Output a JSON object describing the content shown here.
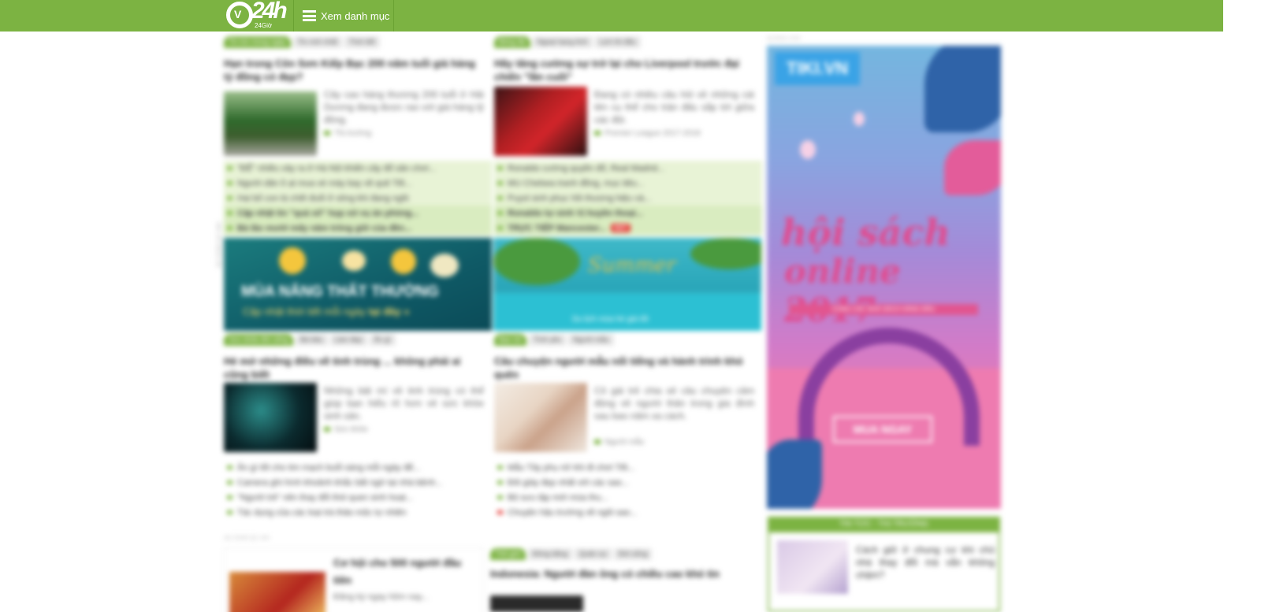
{
  "header": {
    "logo_text": "24h",
    "logo_letter": "V",
    "logo_sub": "24Giờ",
    "menu_label": "Xem danh mục"
  },
  "colors": {
    "brand": "#7cb342",
    "hot": "#e53935"
  },
  "icons": {
    "menu": "hamburger-icon",
    "bullet": "square-bullet-icon"
  },
  "left_col": {
    "block1": {
      "tags": [
        "Tin tức trong ngày",
        "Tin mới nhất",
        "Thời tiết"
      ],
      "headline": "Hạn trong Côn Sơn Kiếp Bạc 200 năm tuổi giá hàng tỷ đồng có đẹp?",
      "summary": "Cây cao hàng thương 200 tuổi ở Hải Dương đang được rao với giá hàng tỷ đồng.",
      "category": "Thị trường",
      "links": [
        "\"ĐỂ\" nhiều xảy ra ở Hà Nội khiến cây đổ sân chơi...",
        "Người dân ồ ạt mua vé máy bay về quê Tết...",
        "Hai bố con bị chết đuối ở sông khi đang ngồi",
        "Cập nhật tin \"quá số\" họp xử vụ án phòng...",
        "Bà lão mười mấy năm trông giữ của đền..."
      ]
    },
    "block2": {
      "tags": [
        "Sức khỏe đời sống",
        "Bà bầu",
        "Làm đẹp",
        "Ăn gì"
      ],
      "headline": "Hé mở những điều về tinh trùng ... không phải ai cũng biết",
      "summary": "Những bật mí về tinh trùng có thể giúp bạn hiểu rõ hơn về sức khỏe sinh sản.",
      "category": "Sức khỏe",
      "links": [
        "Ăn gì tốt cho tim mạch buổi sáng mỗi ngày để...",
        "Camera ghi hình khoảnh khắc bất ngờ tại nhà bệnh...",
        "\"Người trẻ\" nên thay đổi thói quen sinh hoạt...",
        "Tác dụng của các loại trà thảo mộc tự nhiên"
      ]
    },
    "banner": {
      "title": "MÙA NẮNG THẤT THƯỜNG",
      "subtitle": "Cập nhật thời tiết mỗi ngày",
      "cta": "tại đây »"
    },
    "ad_vertical_label": "AD ZONE QC 24H",
    "small_label": "AD ZONE QC 24H",
    "card": {
      "title": "Cơ hội cho 500 người đầu tiên",
      "sub": "Đăng ký ngay hôm nay..."
    }
  },
  "mid_col": {
    "block1": {
      "tags": [
        "Bóng đá",
        "Ngoại hạng Anh",
        "Lịch thi đấu"
      ],
      "headline": "Hãy tăng cường sự trở lại cho Liverpool trước đại chiến \"lần cuối\"",
      "summary": "Đang có nhiều câu hỏi về những cái tên cụ thể cho trận đấu sắp tới giữa các đội.",
      "category": "Premier League 2017-2018",
      "links": [
        "Ronaldo cường quyền đổ, Real Madrid...",
        "MU Chelsea tranh đồng, mục tiêu...",
        "Puyol sinh phục hồi thượng hiệu và...",
        "Ronaldo tự sinh Vị huyền thoại..."
      ],
      "hot_link": "TRỰC TIẾP Mancester...",
      "hot_label": "HOT"
    },
    "block2": {
      "tags": [
        "Bạn trẻ",
        "Tình yêu",
        "Người mẫu"
      ],
      "headline": "Câu chuyện người mẫu nổi tiếng và hành trình khó quên",
      "summary": "Cô gái trẻ chia sẻ câu chuyện cảm động về người thân trong gia đình sau bao năm xa cách.",
      "category": "Người mẫu",
      "links": [
        "Mẫu Tây phụ nữ khi đi chơi Tết...",
        "Đôi giày đẹp nhất với các sao...",
        "Bộ sưu tập mới mùa thu...",
        "Chuyện hậu trường về ngôi sao..."
      ]
    },
    "banner": {
      "script": "Summer",
      "caption": "Du lịch mùa hè giá tốt"
    },
    "block3": {
      "tags": [
        "Thế giới",
        "Đồng bằng",
        "Quân sự",
        "Đời sống"
      ],
      "headline": "Indonesia: Người đàn ông có chiều cao khó tin"
    }
  },
  "right_col": {
    "ad_label": "QUẢNG CÁO",
    "ad": {
      "brand": "TIKI.VN",
      "title_line1": "hội sách",
      "title_line2": "online 2017",
      "strip": "CÙNG CÁC NHÀ SÁCH HÀNG ĐẦU",
      "cta": "MUA NGAY"
    },
    "box": {
      "header": "TIN TỨC - THỊ TRƯỜNG",
      "text": "Cách giữ ở chung cư khi chủ nhà thay đổi mà vẫn không chậm?"
    }
  }
}
